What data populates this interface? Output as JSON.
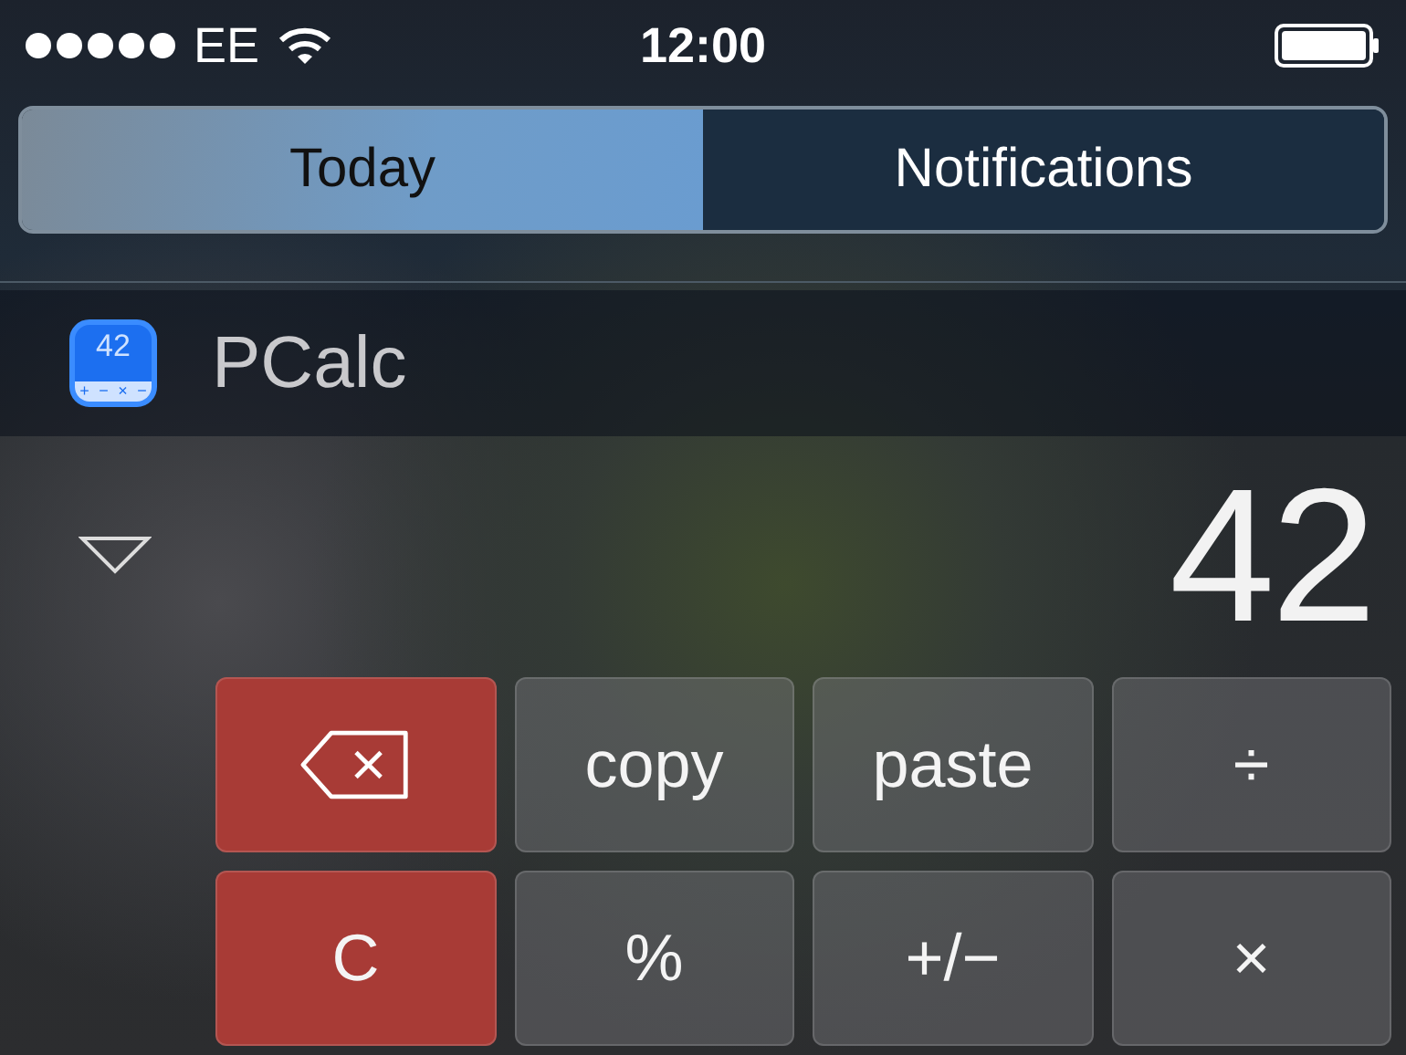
{
  "status_bar": {
    "carrier": "EE",
    "time": "12:00"
  },
  "tabs": [
    {
      "label": "Today",
      "selected": true
    },
    {
      "label": "Notifications",
      "selected": false
    }
  ],
  "widget": {
    "app_name": "PCalc",
    "icon_display": "42",
    "icon_keys": [
      "+",
      "−",
      "×",
      "−"
    ],
    "expanded": true,
    "display": "42",
    "buttons": [
      {
        "kind": "backspace"
      },
      {
        "kind": "function",
        "label": "copy"
      },
      {
        "kind": "function",
        "label": "paste"
      },
      {
        "kind": "function",
        "label": "÷"
      },
      {
        "kind": "clear",
        "label": "C"
      },
      {
        "kind": "function",
        "label": "%"
      },
      {
        "kind": "function",
        "label": "+/−"
      },
      {
        "kind": "function",
        "label": "×"
      }
    ]
  }
}
